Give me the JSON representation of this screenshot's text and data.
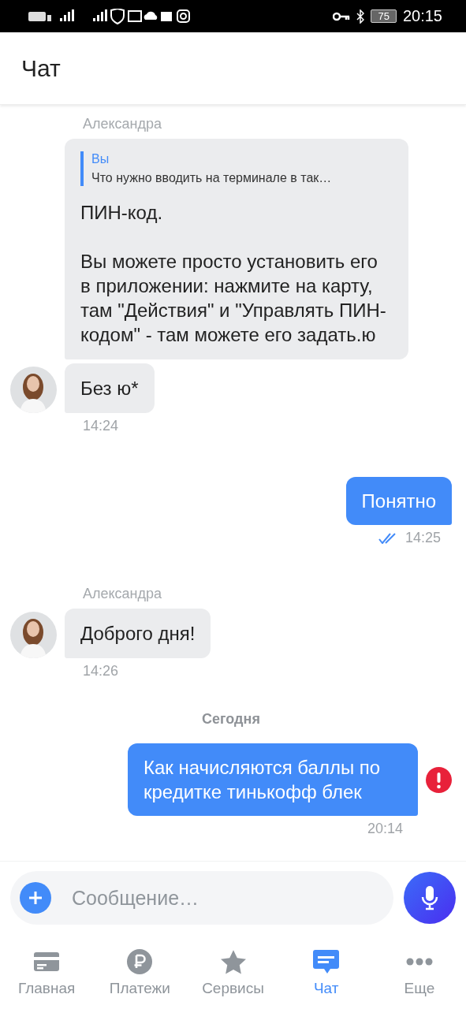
{
  "status_bar": {
    "time": "20:15",
    "battery": "75"
  },
  "header": {
    "title": "Чат"
  },
  "messages": [
    {
      "kind": "incoming",
      "sender": "Александра",
      "avatar": false,
      "quote": {
        "author": "Вы",
        "text": "Что нужно вводить на терминале в так…"
      },
      "text": "ПИН-код.\n\nВы можете просто установить его в приложении: нажмите на карту, там \"Действия\" и \"Управлять ПИН-кодом\" - там можете его задать.ю"
    },
    {
      "kind": "incoming",
      "avatar": true,
      "text": "Без ю*",
      "time": "14:24"
    },
    {
      "kind": "outgoing",
      "text": "Понятно",
      "time": "14:25",
      "read": true,
      "error": false
    },
    {
      "kind": "incoming",
      "sender": "Александра",
      "avatar": true,
      "text": "Доброго дня!",
      "time": "14:26"
    },
    {
      "kind": "date",
      "text": "Сегодня"
    },
    {
      "kind": "outgoing",
      "text": "Как начисляются баллы по кредитке тинькофф блек",
      "time": "20:14",
      "read": false,
      "error": true
    }
  ],
  "composer": {
    "placeholder": "Сообщение…"
  },
  "nav": [
    {
      "label": "Главная",
      "selected": false
    },
    {
      "label": "Платежи",
      "selected": false
    },
    {
      "label": "Сервисы",
      "selected": false
    },
    {
      "label": "Чат",
      "selected": true
    },
    {
      "label": "Еще",
      "selected": false
    }
  ]
}
